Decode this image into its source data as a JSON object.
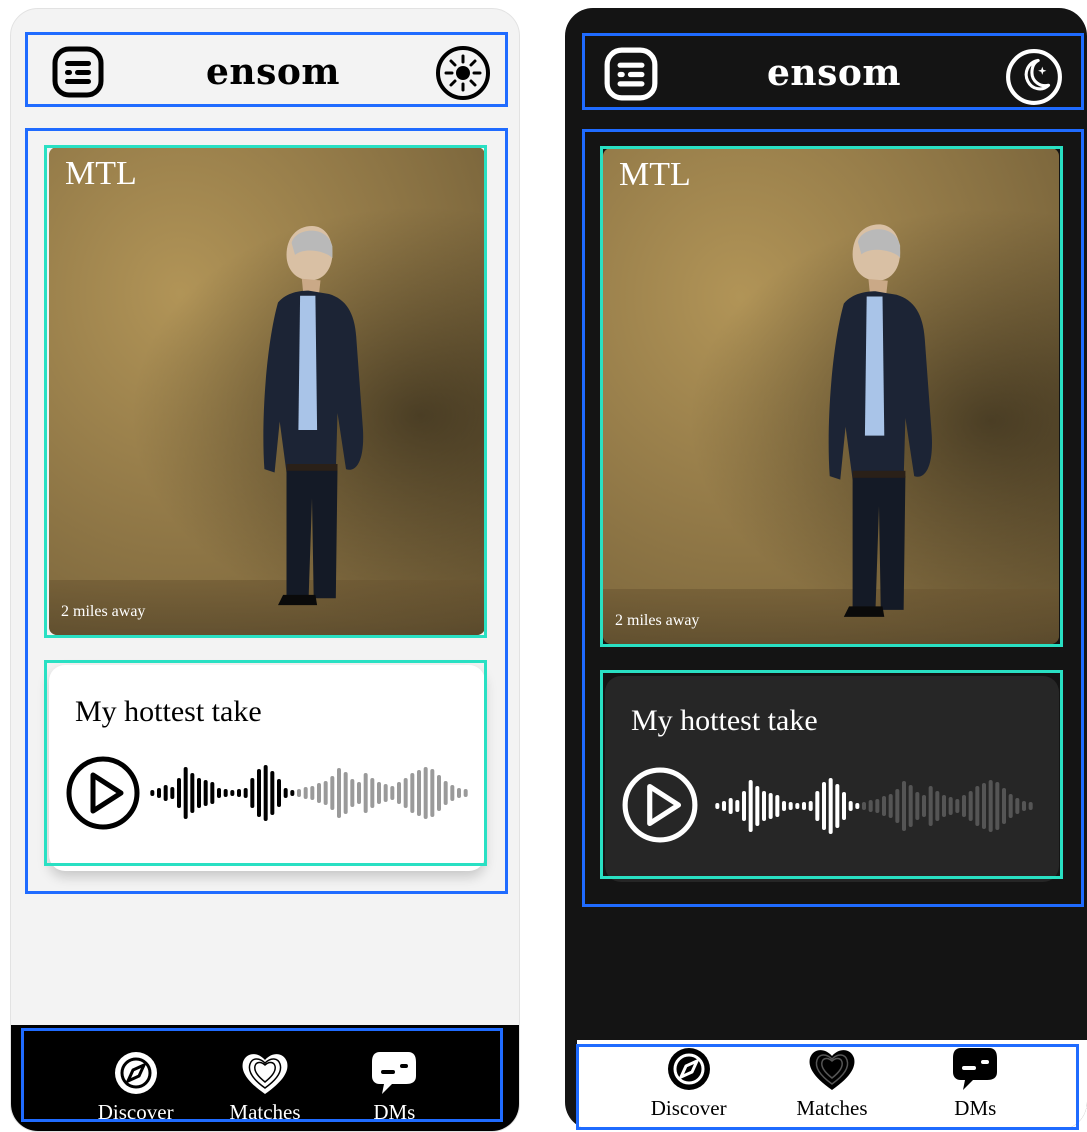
{
  "app": {
    "title": "ensom"
  },
  "profile": {
    "city": "MTL",
    "distance": "2 miles away",
    "prompt_title": "My hottest take"
  },
  "nav": {
    "discover": "Discover",
    "matches": "Matches",
    "dms": "DMs"
  },
  "icons": {
    "menu": "menu-icon",
    "light_mode": "sun-icon",
    "dark_mode": "moon-icon",
    "play": "play-icon",
    "discover": "compass-icon",
    "matches": "hearts-icon",
    "dms": "chat-icon"
  },
  "colors": {
    "highlight_blue": "#1f6bff",
    "highlight_cyan": "#29e0c3",
    "light_bg": "#f3f3f3",
    "dark_bg": "#141414"
  },
  "voice_note": {
    "progress": 0.45
  }
}
